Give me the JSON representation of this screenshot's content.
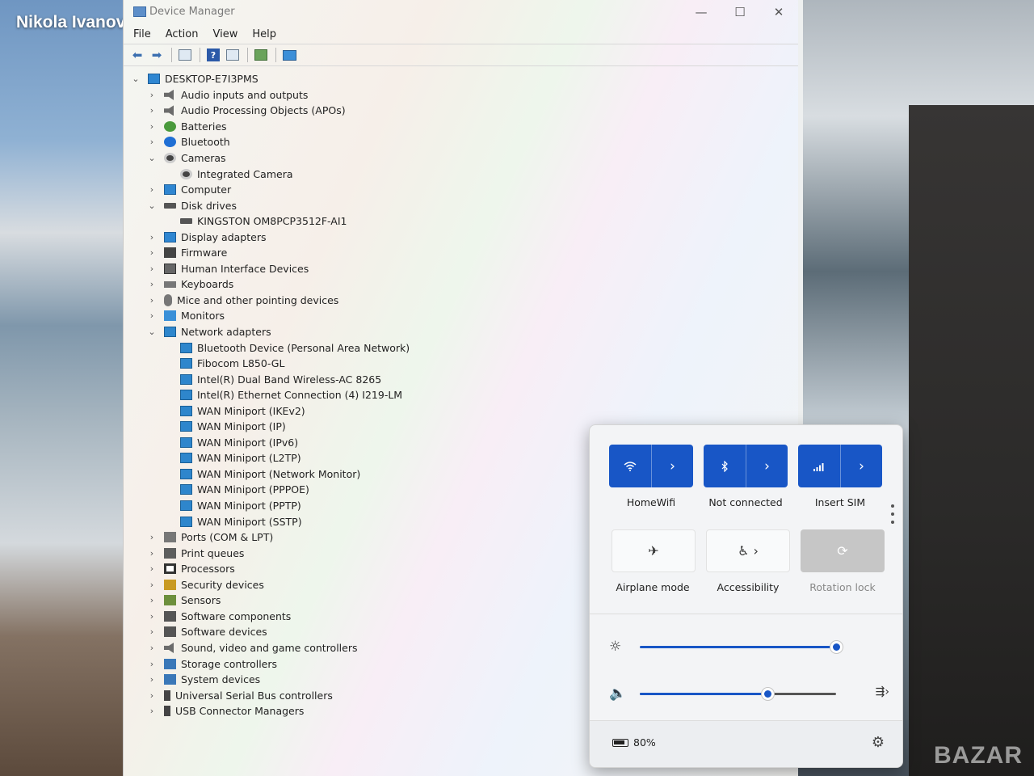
{
  "overlay": {
    "author": "Nikola Ivanov",
    "watermark": "BAZAR"
  },
  "window": {
    "title": "Device Manager",
    "controls": {
      "minimize": "—",
      "maximize": "☐",
      "close": "✕"
    },
    "menu": [
      "File",
      "Action",
      "View",
      "Help"
    ],
    "toolbar_icons": [
      "back-arrow-icon",
      "forward-arrow-icon",
      "properties-icon",
      "help-icon",
      "view-icon",
      "update-driver-icon",
      "scan-hardware-icon"
    ]
  },
  "tree": [
    {
      "label": "DESKTOP-E7I3PMS",
      "level": 0,
      "state": "expanded",
      "icon": "computer"
    },
    {
      "label": "Audio inputs and outputs",
      "level": 1,
      "state": "collapsed",
      "icon": "audio"
    },
    {
      "label": "Audio Processing Objects (APOs)",
      "level": 1,
      "state": "collapsed",
      "icon": "audio"
    },
    {
      "label": "Batteries",
      "level": 1,
      "state": "collapsed",
      "icon": "battery"
    },
    {
      "label": "Bluetooth",
      "level": 1,
      "state": "collapsed",
      "icon": "bt"
    },
    {
      "label": "Cameras",
      "level": 1,
      "state": "expanded",
      "icon": "cam"
    },
    {
      "label": "Integrated Camera",
      "level": 2,
      "state": "leaf",
      "icon": "cam"
    },
    {
      "label": "Computer",
      "level": 1,
      "state": "collapsed",
      "icon": "computer"
    },
    {
      "label": "Disk drives",
      "level": 1,
      "state": "expanded",
      "icon": "disk"
    },
    {
      "label": "KINGSTON OM8PCP3512F-AI1",
      "level": 2,
      "state": "leaf",
      "icon": "disk"
    },
    {
      "label": "Display adapters",
      "level": 1,
      "state": "collapsed",
      "icon": "display"
    },
    {
      "label": "Firmware",
      "level": 1,
      "state": "collapsed",
      "icon": "chip"
    },
    {
      "label": "Human Interface Devices",
      "level": 1,
      "state": "collapsed",
      "icon": "hid"
    },
    {
      "label": "Keyboards",
      "level": 1,
      "state": "collapsed",
      "icon": "kbd"
    },
    {
      "label": "Mice and other pointing devices",
      "level": 1,
      "state": "collapsed",
      "icon": "mouse"
    },
    {
      "label": "Monitors",
      "level": 1,
      "state": "collapsed",
      "icon": "monitor"
    },
    {
      "label": "Network adapters",
      "level": 1,
      "state": "expanded",
      "icon": "net"
    },
    {
      "label": "Bluetooth Device (Personal Area Network)",
      "level": 2,
      "state": "leaf",
      "icon": "net"
    },
    {
      "label": "Fibocom L850-GL",
      "level": 2,
      "state": "leaf",
      "icon": "net"
    },
    {
      "label": "Intel(R) Dual Band Wireless-AC 8265",
      "level": 2,
      "state": "leaf",
      "icon": "net"
    },
    {
      "label": "Intel(R) Ethernet Connection (4) I219-LM",
      "level": 2,
      "state": "leaf",
      "icon": "net"
    },
    {
      "label": "WAN Miniport (IKEv2)",
      "level": 2,
      "state": "leaf",
      "icon": "net"
    },
    {
      "label": "WAN Miniport (IP)",
      "level": 2,
      "state": "leaf",
      "icon": "net"
    },
    {
      "label": "WAN Miniport (IPv6)",
      "level": 2,
      "state": "leaf",
      "icon": "net"
    },
    {
      "label": "WAN Miniport (L2TP)",
      "level": 2,
      "state": "leaf",
      "icon": "net"
    },
    {
      "label": "WAN Miniport (Network Monitor)",
      "level": 2,
      "state": "leaf",
      "icon": "net"
    },
    {
      "label": "WAN Miniport (PPPOE)",
      "level": 2,
      "state": "leaf",
      "icon": "net"
    },
    {
      "label": "WAN Miniport (PPTP)",
      "level": 2,
      "state": "leaf",
      "icon": "net"
    },
    {
      "label": "WAN Miniport (SSTP)",
      "level": 2,
      "state": "leaf",
      "icon": "net"
    },
    {
      "label": "Ports (COM & LPT)",
      "level": 1,
      "state": "collapsed",
      "icon": "port"
    },
    {
      "label": "Print queues",
      "level": 1,
      "state": "collapsed",
      "icon": "print"
    },
    {
      "label": "Processors",
      "level": 1,
      "state": "collapsed",
      "icon": "proc"
    },
    {
      "label": "Security devices",
      "level": 1,
      "state": "collapsed",
      "icon": "sec"
    },
    {
      "label": "Sensors",
      "level": 1,
      "state": "collapsed",
      "icon": "sensor"
    },
    {
      "label": "Software components",
      "level": 1,
      "state": "collapsed",
      "icon": "sw"
    },
    {
      "label": "Software devices",
      "level": 1,
      "state": "collapsed",
      "icon": "sw"
    },
    {
      "label": "Sound, video and game controllers",
      "level": 1,
      "state": "collapsed",
      "icon": "audio"
    },
    {
      "label": "Storage controllers",
      "level": 1,
      "state": "collapsed",
      "icon": "sys"
    },
    {
      "label": "System devices",
      "level": 1,
      "state": "collapsed",
      "icon": "sys"
    },
    {
      "label": "Universal Serial Bus controllers",
      "level": 1,
      "state": "collapsed",
      "icon": "usb"
    },
    {
      "label": "USB Connector Managers",
      "level": 1,
      "state": "collapsed",
      "icon": "usb"
    }
  ],
  "quick_settings": {
    "tiles": {
      "wifi": {
        "label": "HomeWifi",
        "state": "on",
        "icon": "wifi-icon"
      },
      "bluetooth": {
        "label": "Not connected",
        "state": "on",
        "icon": "bluetooth-icon"
      },
      "cellular": {
        "label": "Insert SIM",
        "state": "on",
        "icon": "cellular-icon"
      },
      "airplane": {
        "label": "Airplane mode",
        "state": "off",
        "icon": "airplane-icon"
      },
      "accessibility": {
        "label": "Accessibility",
        "state": "off",
        "icon": "accessibility-icon"
      },
      "rotation": {
        "label": "Rotation lock",
        "state": "disabled",
        "icon": "rotation-lock-icon"
      }
    },
    "brightness_level": 1.0,
    "volume_level": 0.65,
    "battery": "80%",
    "accent_color": "#1856c6"
  }
}
